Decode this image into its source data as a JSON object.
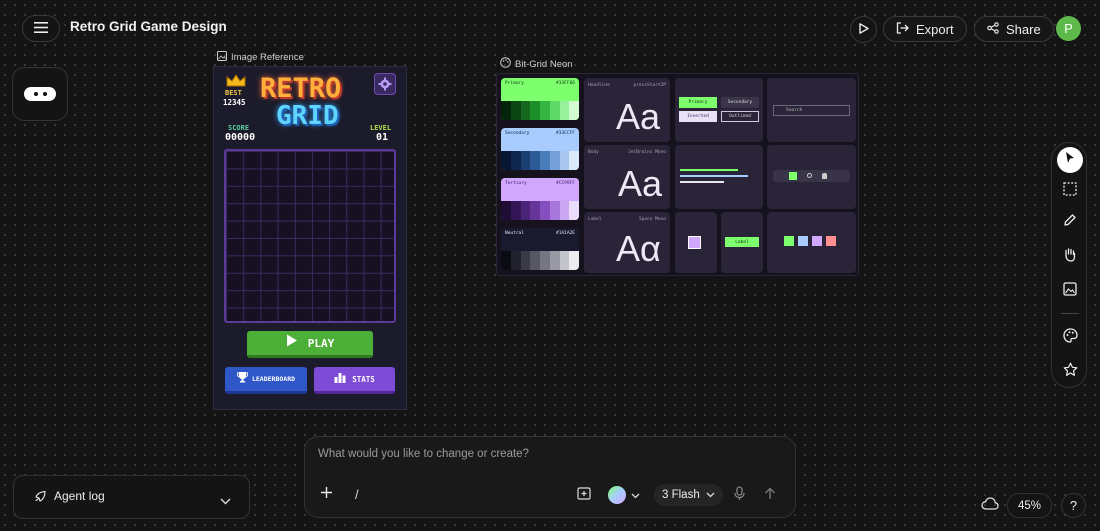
{
  "header": {
    "title": "Retro Grid Game Design",
    "export_label": "Export",
    "share_label": "Share",
    "avatar_letter": "P",
    "avatar_color": "#5db94a"
  },
  "frames": {
    "image_reference_label": "Image Reference",
    "style_guide_label": "Bit-Grid Neon"
  },
  "game": {
    "best_label": "BEST",
    "best_value": "12345",
    "title_line1": "RETRO",
    "title_line2": "GRID",
    "score_label": "SCORE",
    "score_value": "00000",
    "level_label": "LEVEL",
    "level_value": "01",
    "play_label": "PLAY",
    "leaderboard_label": "LEADERBOARD",
    "stats_label": "STATS"
  },
  "style_guide": {
    "swatches": [
      {
        "name": "Primary",
        "hex": "#33FF66",
        "color": "#7dff6e"
      },
      {
        "name": "Secondary",
        "hex": "#33CCFF",
        "color": "#a9ccff"
      },
      {
        "name": "Tertiary",
        "hex": "#CC99FF",
        "color": "#d2a8ff"
      },
      {
        "name": "Neutral",
        "hex": "#1A1A2E",
        "color": "#1a1a2e"
      }
    ],
    "type": [
      {
        "role": "Headline",
        "font": "pressStart2P",
        "sample": "Aa"
      },
      {
        "role": "Body",
        "font": "JetBrains Mono",
        "sample": "Aa"
      },
      {
        "role": "Label",
        "font": "Space Mono",
        "sample": "Aα"
      }
    ],
    "buttons": [
      "Primary",
      "Secondary",
      "Inverted",
      "Outlined"
    ],
    "search_placeholder": "Search",
    "chip_label": "Label"
  },
  "prompt": {
    "placeholder": "What would you like to change or create?",
    "slash": "/",
    "model_label": "3 Flash"
  },
  "bottom": {
    "agent_log_label": "Agent log",
    "zoom_label": "45%",
    "help_label": "?"
  }
}
